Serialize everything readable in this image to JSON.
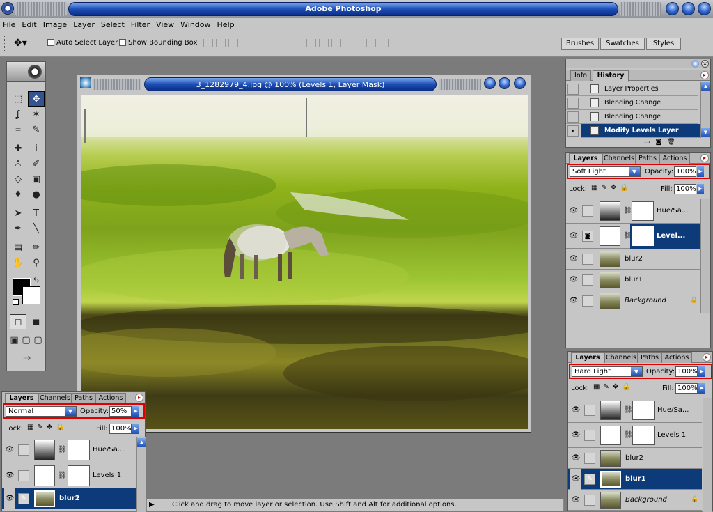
{
  "app": {
    "title": "Adobe Photoshop"
  },
  "menu": [
    "File",
    "Edit",
    "Image",
    "Layer",
    "Select",
    "Filter",
    "View",
    "Window",
    "Help"
  ],
  "options": {
    "auto_select": "Auto Select Layer",
    "bounding_box": "Show Bounding Box"
  },
  "well_tabs": [
    "Brushes",
    "Swatches",
    "Styles"
  ],
  "document": {
    "title": "3_1282979_4.jpg @ 100% (Levels 1, Layer Mask)"
  },
  "status": "Click and drag to move layer or selection.  Use Shift and Alt for additional options.",
  "history_panel": {
    "tabs": [
      "Info",
      "History"
    ],
    "items": [
      "Layer Properties",
      "Blending Change",
      "Blending Change",
      "Modify Levels Layer"
    ]
  },
  "layer_panels": [
    {
      "tabs": [
        "Layers",
        "Channels",
        "Paths",
        "Actions"
      ],
      "blend_mode": "Soft Light",
      "opacity_label": "Opacity:",
      "opacity": "100%",
      "lock_label": "Lock:",
      "fill_label": "Fill:",
      "fill": "100%",
      "layers": [
        {
          "name": "Hue/Sa...",
          "thumb": "grad",
          "mask": true
        },
        {
          "name": "Level...",
          "thumb": "lev",
          "mask": true,
          "selected": true
        },
        {
          "name": "blur2",
          "thumb": "img"
        },
        {
          "name": "blur1",
          "thumb": "img"
        },
        {
          "name": "Background",
          "thumb": "img",
          "locked": true
        }
      ]
    },
    {
      "tabs": [
        "Layers",
        "Channels",
        "Paths",
        "Actions"
      ],
      "blend_mode": "Hard Light",
      "opacity_label": "Opacity:",
      "opacity": "100%",
      "lock_label": "Lock:",
      "fill_label": "Fill:",
      "fill": "100%",
      "layers": [
        {
          "name": "Hue/Sa...",
          "thumb": "grad",
          "mask": true
        },
        {
          "name": "Levels 1",
          "thumb": "lev",
          "mask": true
        },
        {
          "name": "blur2",
          "thumb": "img"
        },
        {
          "name": "blur1",
          "thumb": "img",
          "selected": true
        },
        {
          "name": "Background",
          "thumb": "img",
          "locked": true
        }
      ]
    },
    {
      "tabs": [
        "Layers",
        "Channels",
        "Paths",
        "Actions"
      ],
      "blend_mode": "Normal",
      "opacity_label": "Opacity:",
      "opacity": "50%",
      "lock_label": "Lock:",
      "fill_label": "Fill:",
      "fill": "100%",
      "layers": [
        {
          "name": "Hue/Sa...",
          "thumb": "grad",
          "mask": true
        },
        {
          "name": "Levels 1",
          "thumb": "lev",
          "mask": true
        },
        {
          "name": "blur2",
          "thumb": "img",
          "selected": true
        }
      ]
    }
  ],
  "colors": {
    "title_blue": "#1d4fb6",
    "selection": "#0d3b7a",
    "highlight_box": "#e00000"
  }
}
